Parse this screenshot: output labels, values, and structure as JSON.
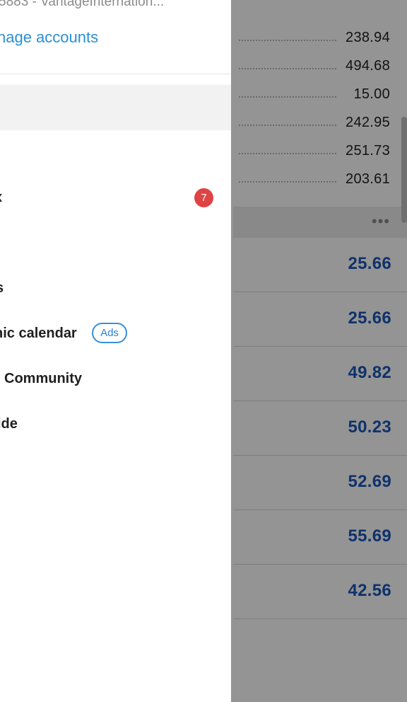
{
  "drawer": {
    "account_line": "5883 - VantageInternation...",
    "manage_accounts": "nage accounts",
    "items": [
      {
        "label": "x"
      },
      {
        "label": "s"
      },
      {
        "label": "nic calendar"
      },
      {
        "label": "Community"
      },
      {
        "label": "ide"
      }
    ],
    "mailbox_badge": "7",
    "ads_badge": "Ads"
  },
  "background": {
    "top_values": [
      "238.94",
      "494.68",
      "15.00",
      "242.95",
      "251.73",
      "203.61"
    ],
    "more_icon": "•••",
    "blue_values": [
      "25.66",
      "25.66",
      "49.82",
      "50.23",
      "52.69",
      "55.69",
      "42.56"
    ]
  },
  "colors": {
    "accent_blue": "#2a8fd6",
    "value_blue": "#1a56b8",
    "badge_red": "#e04343"
  }
}
